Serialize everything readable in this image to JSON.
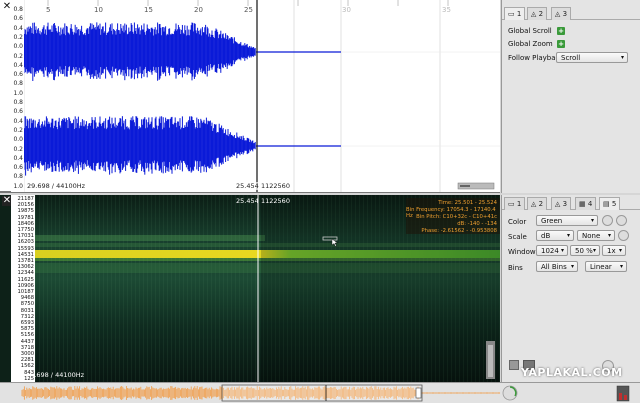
{
  "top_pane": {
    "close_label": "✕",
    "amplitude_scale": [
      "0.8",
      "0.6",
      "0.4",
      "0.2",
      "0.0",
      "0.2",
      "0.4",
      "0.6",
      "0.8",
      "1.0",
      "0.8",
      "0.6",
      "0.4",
      "0.2",
      "0.0",
      "0.2",
      "0.4",
      "0.6",
      "0.8",
      "1.0"
    ],
    "ruler_labels": [
      "5",
      "10",
      "15",
      "20",
      "25",
      "30",
      "35"
    ],
    "status_left": "29.698 / 44100Hz",
    "cursor_time": "25.454",
    "cursor_frame": "1122560"
  },
  "top_props": {
    "tabs": [
      "1",
      "2",
      "3"
    ],
    "global_scroll_label": "Global Scroll",
    "global_zoom_label": "Global Zoom",
    "follow_playback_label": "Follow Playback",
    "follow_playback_value": "Scroll"
  },
  "spec_pane": {
    "close_label": "✕",
    "freq_labels": [
      "21187",
      "20156",
      "19875",
      "19781",
      "18406",
      "17750",
      "17031",
      "16203",
      "15593",
      "14531",
      "13781",
      "13062",
      "12344",
      "11625",
      "10906",
      "10187",
      "9468",
      "8750",
      "8031",
      "7312",
      "6593",
      "5875",
      "5156",
      "4437",
      "3718",
      "3000",
      "2281",
      "1562",
      "843",
      "125"
    ],
    "cursor_time": "25.454",
    "cursor_frame": "1122560",
    "status_left": "29.698 / 44100Hz",
    "overlay": {
      "time": "Time: 25.501 - 25.524",
      "bin_frequency": "Bin Frequency: 17054.3 - 17140.4 Hz",
      "bin_pitch": "Bin Pitch: C10+32c - C10+41c",
      "db": "dB: -140 - -134",
      "phase": "Phase: -2.61562 - -0.953808"
    }
  },
  "bottom_props": {
    "tabs": [
      "1",
      "2",
      "3",
      "4",
      "5"
    ],
    "color_label": "Color",
    "color_value": "Green",
    "scale_label": "Scale",
    "scale_value": "dB",
    "scale_value_2": "None",
    "window_label": "Window",
    "window_value": "1024",
    "window_overlap": "50 %",
    "window_zoom": "1x",
    "bins_label": "Bins",
    "bins_value": "All Bins",
    "bins_scale": "Linear"
  },
  "watermark": "YAPLAKAL.COM",
  "colors": {
    "waveform": "#0a1ad8",
    "spectrogram_bg": "#0d2118",
    "spectrogram_band": "#e8d020",
    "overlay_text": "#f0a030",
    "overview_wave": "#f0a050"
  }
}
